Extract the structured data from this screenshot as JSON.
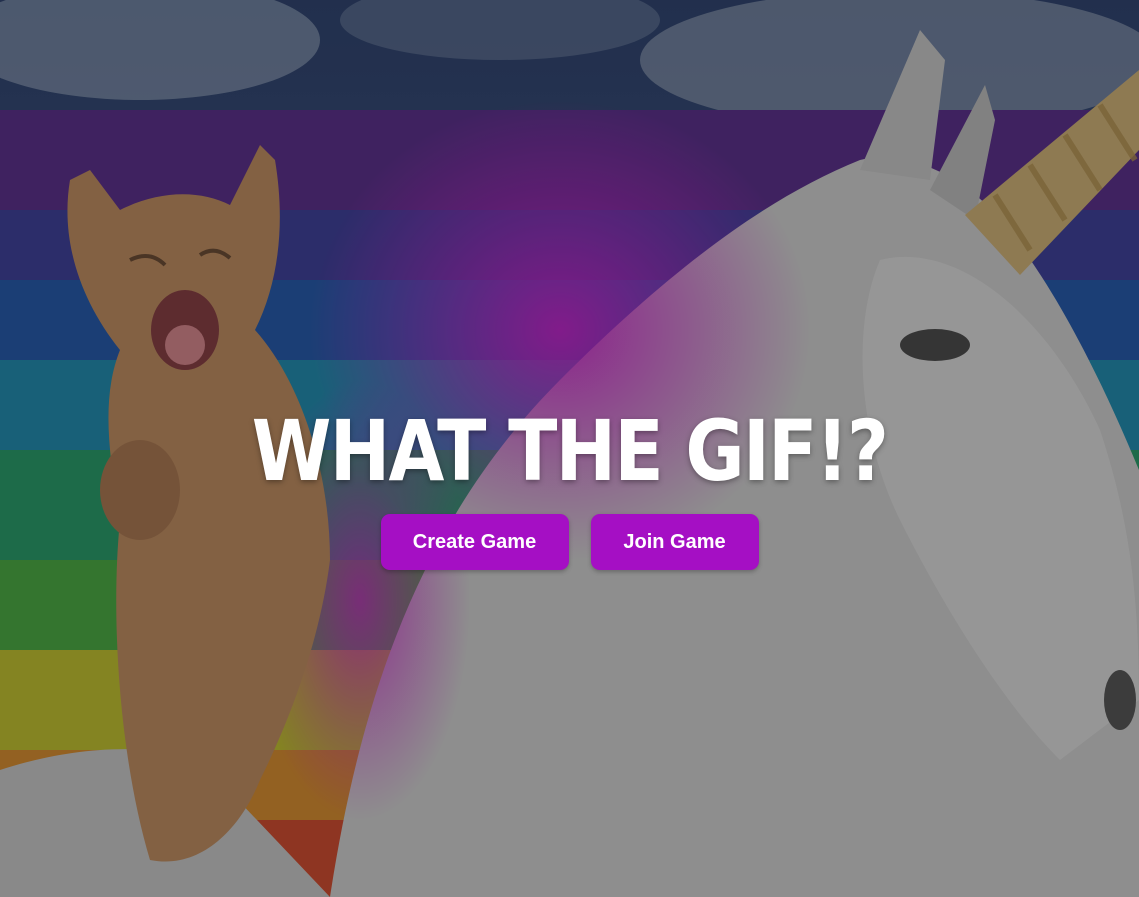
{
  "title": "WHAT THE GIF!?",
  "buttons": {
    "create_label": "Create Game",
    "join_label": "Join Game"
  },
  "colors": {
    "button": "#a50fc4",
    "title": "#ffffff"
  },
  "background_image": "cat riding unicorn in front of rainbow stripes"
}
